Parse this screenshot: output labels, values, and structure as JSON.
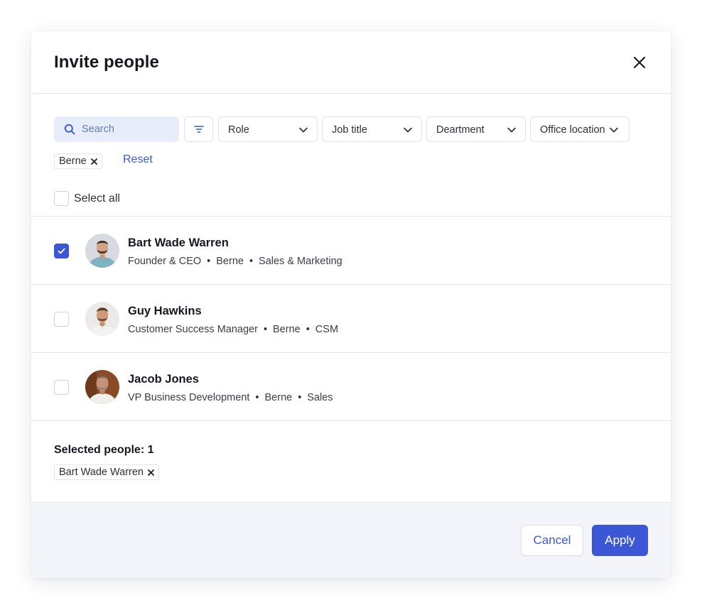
{
  "modal": {
    "title": "Invite people"
  },
  "search": {
    "placeholder": "Search",
    "value": ""
  },
  "filters": {
    "role_label": "Role",
    "job_title_label": "Job title",
    "department_label": "Deartment",
    "office_location_label": "Office location"
  },
  "active_filters": {
    "chips": [
      "Berne"
    ],
    "reset_label": "Reset"
  },
  "select_all": {
    "label": "Select all",
    "checked": false
  },
  "people": [
    {
      "name": "Bart Wade Warren",
      "title": "Founder & CEO",
      "location": "Berne",
      "department": "Sales & Marketing",
      "checked": true
    },
    {
      "name": "Guy Hawkins",
      "title": "Customer Success Manager",
      "location": "Berne",
      "department": "CSM",
      "checked": false
    },
    {
      "name": "Jacob Jones",
      "title": "VP Business Development",
      "location": "Berne",
      "department": "Sales",
      "checked": false
    }
  ],
  "selected": {
    "heading": "Selected people: 1",
    "chips": [
      "Bart Wade Warren"
    ]
  },
  "footer": {
    "cancel_label": "Cancel",
    "apply_label": "Apply"
  },
  "colors": {
    "accent": "#3b57d6",
    "search_bg": "#e8edfa",
    "footer_bg": "#f3f5fb",
    "border": "#e3e6ec"
  },
  "icons": {
    "close": "close-icon",
    "search": "search-icon",
    "filter": "filter-lines-icon",
    "dropdown": "chevron-down-icon",
    "remove": "x-icon",
    "check": "checkmark-icon"
  }
}
